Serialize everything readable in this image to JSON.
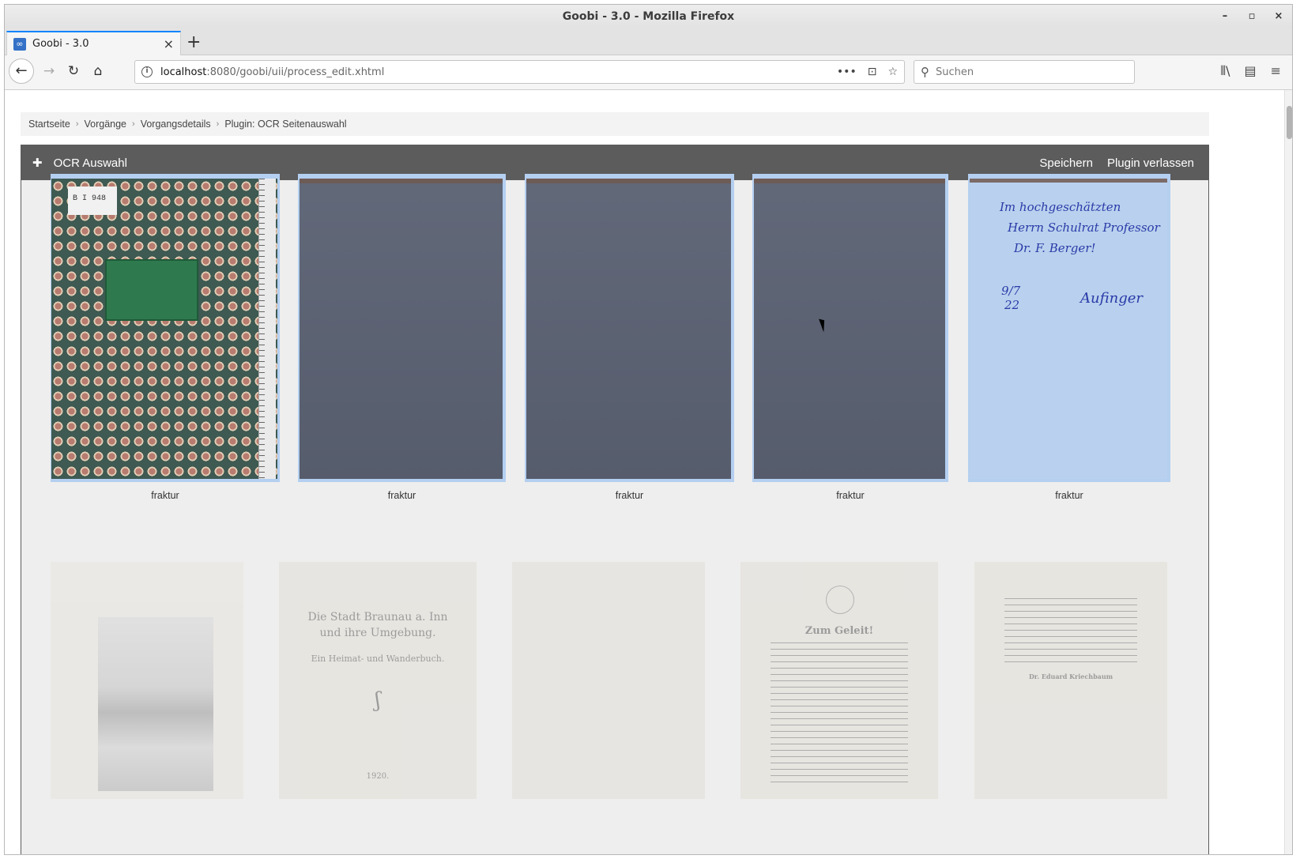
{
  "window": {
    "title": "Goobi - 3.0 - Mozilla Firefox",
    "controls": [
      "–",
      "▫",
      "×"
    ]
  },
  "tab": {
    "title": "Goobi - 3.0",
    "favicon": "∞",
    "close": "×",
    "new_tab": "+"
  },
  "nav": {
    "back": "←",
    "forward": "→",
    "reload": "↻",
    "home": "⌂",
    "url_host": "localhost",
    "url_rest": ":8080/goobi/uii/process_edit.xhtml",
    "url_actions": [
      "•••",
      "⊡",
      "☆"
    ],
    "search_placeholder": "Suchen",
    "toolbar_right": [
      "⫴\\",
      "▤",
      "≡"
    ]
  },
  "breadcrumb": {
    "items": [
      "Startseite",
      "Vorgänge",
      "Vorgangsdetails",
      "Plugin: OCR Seitenauswahl"
    ],
    "separator": "›"
  },
  "plugin": {
    "icon": "✚",
    "title": "OCR Auswahl",
    "save_label": "Speichern",
    "exit_label": "Plugin verlassen"
  },
  "thumbnails_row1": [
    {
      "label": "fraktur",
      "type": "cover",
      "selected": true,
      "sticker": "B I 948"
    },
    {
      "label": "fraktur",
      "type": "blank",
      "selected": true
    },
    {
      "label": "fraktur",
      "type": "blank",
      "selected": true
    },
    {
      "label": "fraktur",
      "type": "blank",
      "selected": true
    },
    {
      "label": "fraktur",
      "type": "handwritten",
      "selected": true,
      "handwriting": [
        "Im hochgeschätzten",
        "Herrn Schulrat Professor",
        "Dr. F. Berger!",
        "9/7",
        "22",
        "Aufinger"
      ]
    }
  ],
  "thumbnails_row2": [
    {
      "type": "photo",
      "selected": false
    },
    {
      "type": "title-page",
      "selected": false,
      "lines": [
        "Die Stadt Braunau a. Inn",
        "und ihre Umgebung.",
        "Ein Heimat- und Wanderbuch."
      ],
      "year": "1920."
    },
    {
      "type": "blank-page",
      "selected": false
    },
    {
      "type": "text-page",
      "selected": false,
      "heading": "Zum Geleit!"
    },
    {
      "type": "text-page-2",
      "selected": false,
      "signature": "Dr. Eduard Kriechbaum"
    }
  ],
  "colors": {
    "selected_frame": "#b4cff0",
    "header_bg": "#5c5c5c",
    "accent_tab": "#0a84ff"
  }
}
